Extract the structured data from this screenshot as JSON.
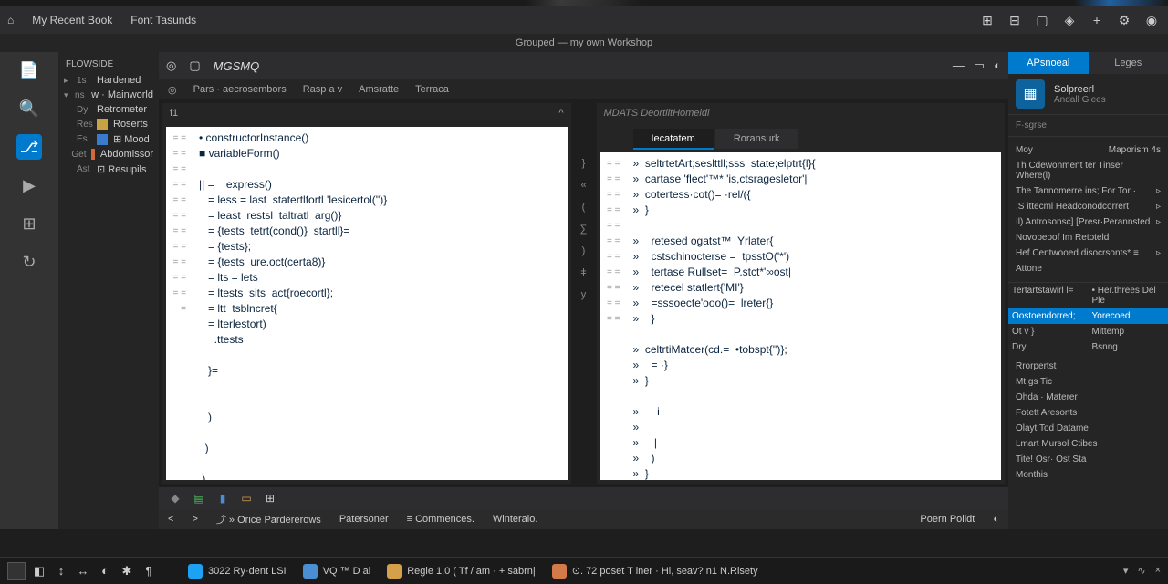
{
  "titlebar": {
    "app_icon": "⌂",
    "menu": [
      "My Recent Book",
      "Font Tasunds"
    ],
    "right_icons": [
      "⊞",
      "⊟",
      "▢",
      "◈",
      "+",
      "⚙",
      "◉"
    ]
  },
  "subtitle": "Grouped — my own Workshop",
  "activity": [
    {
      "icon": "📄",
      "name": "explorer-icon"
    },
    {
      "icon": "🔍",
      "name": "search-icon"
    },
    {
      "icon": "⎇",
      "name": "source-control-icon"
    },
    {
      "icon": "▶",
      "name": "run-icon"
    },
    {
      "icon": "⊞",
      "name": "extensions-icon"
    },
    {
      "icon": "↻",
      "name": "sync-icon"
    }
  ],
  "sidebar": {
    "header": "Flowside",
    "items": [
      {
        "chev": "▸",
        "num": "1s",
        "label": "Hardened"
      },
      {
        "chev": "▾",
        "num": "ns",
        "label": "w · Mainworld"
      },
      {
        "chev": "",
        "num": "Dy",
        "label": "Retrometer"
      },
      {
        "chev": "",
        "num": "Res",
        "label": "Roserts",
        "fi": "fi-yellow"
      },
      {
        "chev": "",
        "num": "Es",
        "label": "⊞ Mood",
        "fi": "fi-blue"
      },
      {
        "chev": "",
        "num": "Get",
        "label": "Abdomissor",
        "fi": "fi-orange"
      },
      {
        "chev": "",
        "num": "Ast",
        "label": "⊡ Resupils"
      }
    ]
  },
  "editor_toolbar": {
    "icons_left": [
      "◎",
      "▢"
    ],
    "title": "MGSMQ",
    "icons_right": [
      "—",
      "▭",
      "◐"
    ]
  },
  "crumbs": [
    "◎",
    "Pars · aecrosembors",
    "Rasp a v",
    "Amsratte",
    "Terraca"
  ],
  "left_pane": {
    "head": "f1",
    "lines": [
      "• constructorInstance()",
      "■ variableForm()",
      "",
      "|| =    express()",
      "   = less = last  statertlfortl 'lesicertol('')}",
      "   = least  restsl  taltratl  arg()}",
      "   = {tests  tetrt(cond()}  startll}=",
      "   = {tests};",
      "   = {tests  ure.oct(certa8)}",
      "   = lts = lets",
      "   = ltests  sits  act{roecortl};",
      "   = ltt  tsblncret{",
      "   = lterlestort)",
      "     .ttests",
      "",
      "   }=",
      "",
      "",
      "   )",
      "",
      "  )",
      "",
      " )"
    ]
  },
  "right_pane": {
    "head_title": "MDATS   DeortlitHomeidl",
    "tabs": [
      "Iecatatem",
      "Roransurk"
    ],
    "lines": [
      "»  seltrtetArt;seslttll;sss  state;elptrt{l}{",
      "»  cartase 'flect'™* 'is,ctsragesletor'|",
      "»  cotertess·cot()= ·rel/({",
      "»  }",
      "",
      "»    retesed ogatst™  Yrlater{",
      "»    cstschinocterse =  tpsstO('*')",
      "»    tertase Rullset=  P.stct*'∞ost|",
      "»    retecel statlert{'MI'}",
      "»    =sssoecte'ooo()=  lreter{}",
      "»    }",
      "",
      "»  celtrtiMatcer(cd.=  •tobspt{'')};",
      "»    = ·}",
      "»  }",
      "",
      "»      i",
      "»",
      "»     |",
      "»    )",
      "»  }",
      "» "
    ]
  },
  "bottom_icons": [
    "◆",
    "▤",
    "▮",
    "▭",
    "⊞"
  ],
  "statusbar": {
    "left": [
      "<",
      ">"
    ],
    "items": [
      "⤴ »   Orice Pardererows",
      "Patersoner",
      "≡    Commences.",
      "Winteralo."
    ],
    "right": [
      "Poern Polidt",
      "◐"
    ]
  },
  "right_panel": {
    "tabs": [
      "APsnoeal",
      "Leges"
    ],
    "asset": {
      "title": "Solpreerl",
      "subtitle": "Andall Glees"
    },
    "fsgerse": "F·sgrse",
    "rows": [
      {
        "l": "Moy",
        "r": "Maporism 4s"
      },
      {
        "l": "Th Cdewonment ter Tinser Where(l)",
        "r": ""
      },
      {
        "l": "The Tannomerre ins; For Tor ·",
        "r": "▹"
      },
      {
        "l": "!S ittecml  Headconodcorrert ",
        "r": "▹"
      },
      {
        "l": "Il) Antrosonsc]  [Presr·Perannsted ",
        "r": "▹"
      },
      {
        "l": "Novopeoof  Im Retoteld",
        "r": ""
      },
      {
        "l": "Hef Centwooed disocrsonts* ≡",
        "r": "▹"
      },
      {
        "l": "Attone",
        "r": ""
      }
    ],
    "two_col": [
      {
        "l": "Tertartstawirl l=",
        "r": "• Her.threes Del Ple"
      },
      {
        "l": "Oostoendorred;",
        "r": "Yorecoed",
        "hl": true
      },
      {
        "l": "Ot v   }",
        "r": "Mittemp"
      },
      {
        "l": "Dry",
        "r": "Bsnng"
      }
    ],
    "list": [
      "Rrorpertst",
      "Mt.gs  Tic",
      "Ohda  · Materer",
      "Fotett  Aresonts",
      "Olayt  Tod Datame",
      "Lmart  Mursol Ctibes",
      "Tite!  Osr· Ost Sta",
      "Monthis"
    ]
  },
  "taskbar": {
    "quick": [
      "◧",
      "↕",
      "↔",
      "◐",
      "✱",
      "¶"
    ],
    "apps": [
      {
        "color": "#1da1f2",
        "text": "3022  Ry·dent LSI"
      },
      {
        "color": "#4a8fd4",
        "text": "VQ  ™   D  al"
      },
      {
        "color": "#d4a04a",
        "text": "Regie  1.0  ( Tf / am · + sabrn|"
      },
      {
        "color": "#d47a4a",
        "text": "⊙.   72   poset T iner · Hl, seav?   n1 N.Risety"
      }
    ],
    "right": [
      "▾",
      "∿",
      "×"
    ]
  }
}
